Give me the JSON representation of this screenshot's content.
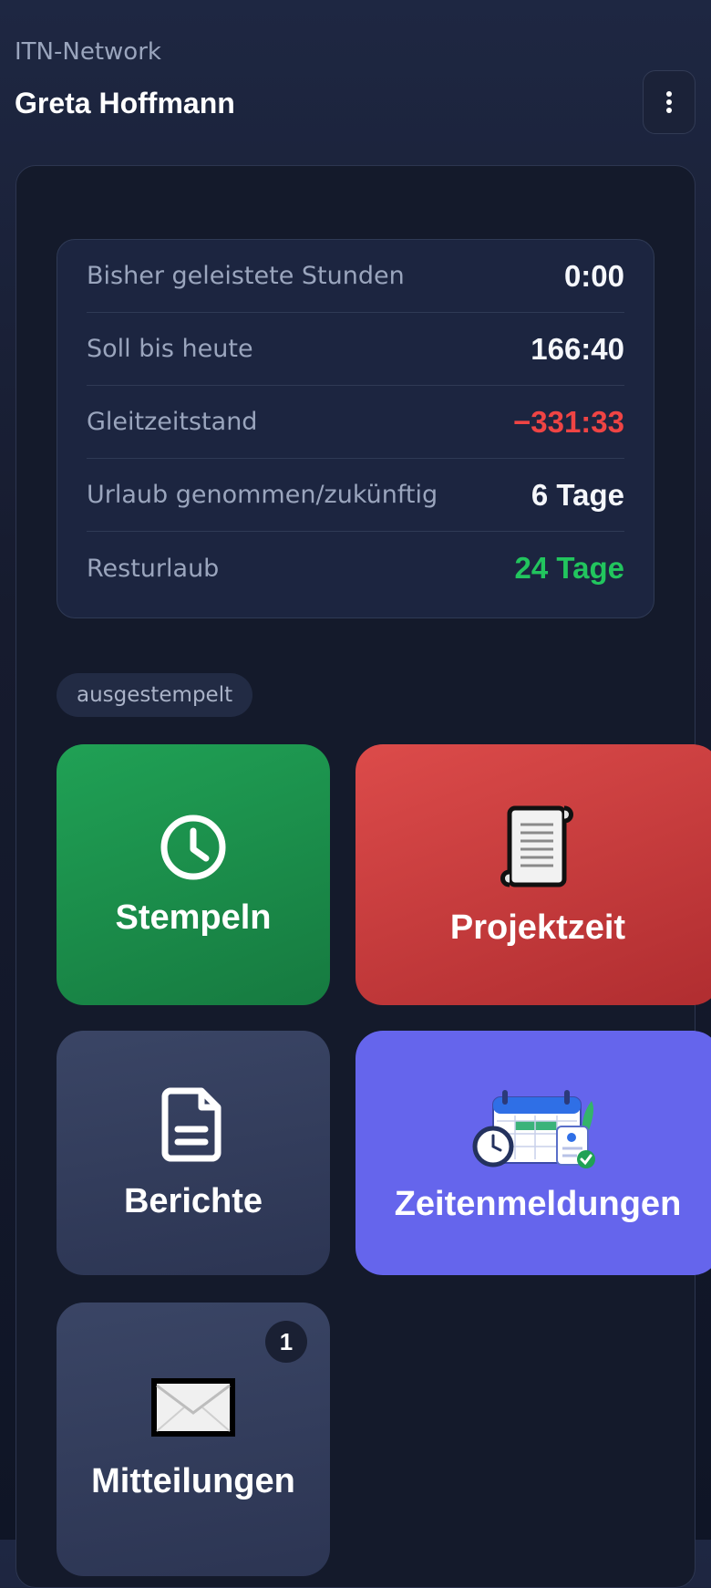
{
  "header": {
    "org_name": "ITN-Network",
    "user_name": "Greta Hoffmann",
    "menu_icon": "more-vertical-icon"
  },
  "stats": [
    {
      "label": "Bisher geleistete Stunden",
      "value": "0:00",
      "color": "#f5f7fb"
    },
    {
      "label": "Soll bis heute",
      "value": "166:40",
      "color": "#f5f7fb"
    },
    {
      "label": "Gleitzeitstand",
      "value": "−331:33",
      "color": "#ef4444"
    },
    {
      "label": "Urlaub genommen/zukünftig",
      "value": "6 Tage",
      "color": "#f5f7fb"
    },
    {
      "label": "Resturlaub",
      "value": "24 Tage",
      "color": "#22c55e"
    }
  ],
  "status": "ausgestempelt",
  "tiles": {
    "stempeln": {
      "label": "Stempeln",
      "icon": "clock-icon"
    },
    "projektzeit": {
      "label": "Projektzeit",
      "icon": "scroll-icon"
    },
    "berichte": {
      "label": "Berichte",
      "icon": "document-icon"
    },
    "zeitenmeldungen": {
      "label": "Zeitenmeldungen",
      "icon": "calendar-icon"
    },
    "mitteilungen": {
      "label": "Mitteilungen",
      "icon": "envelope-icon",
      "badge": "1"
    }
  }
}
